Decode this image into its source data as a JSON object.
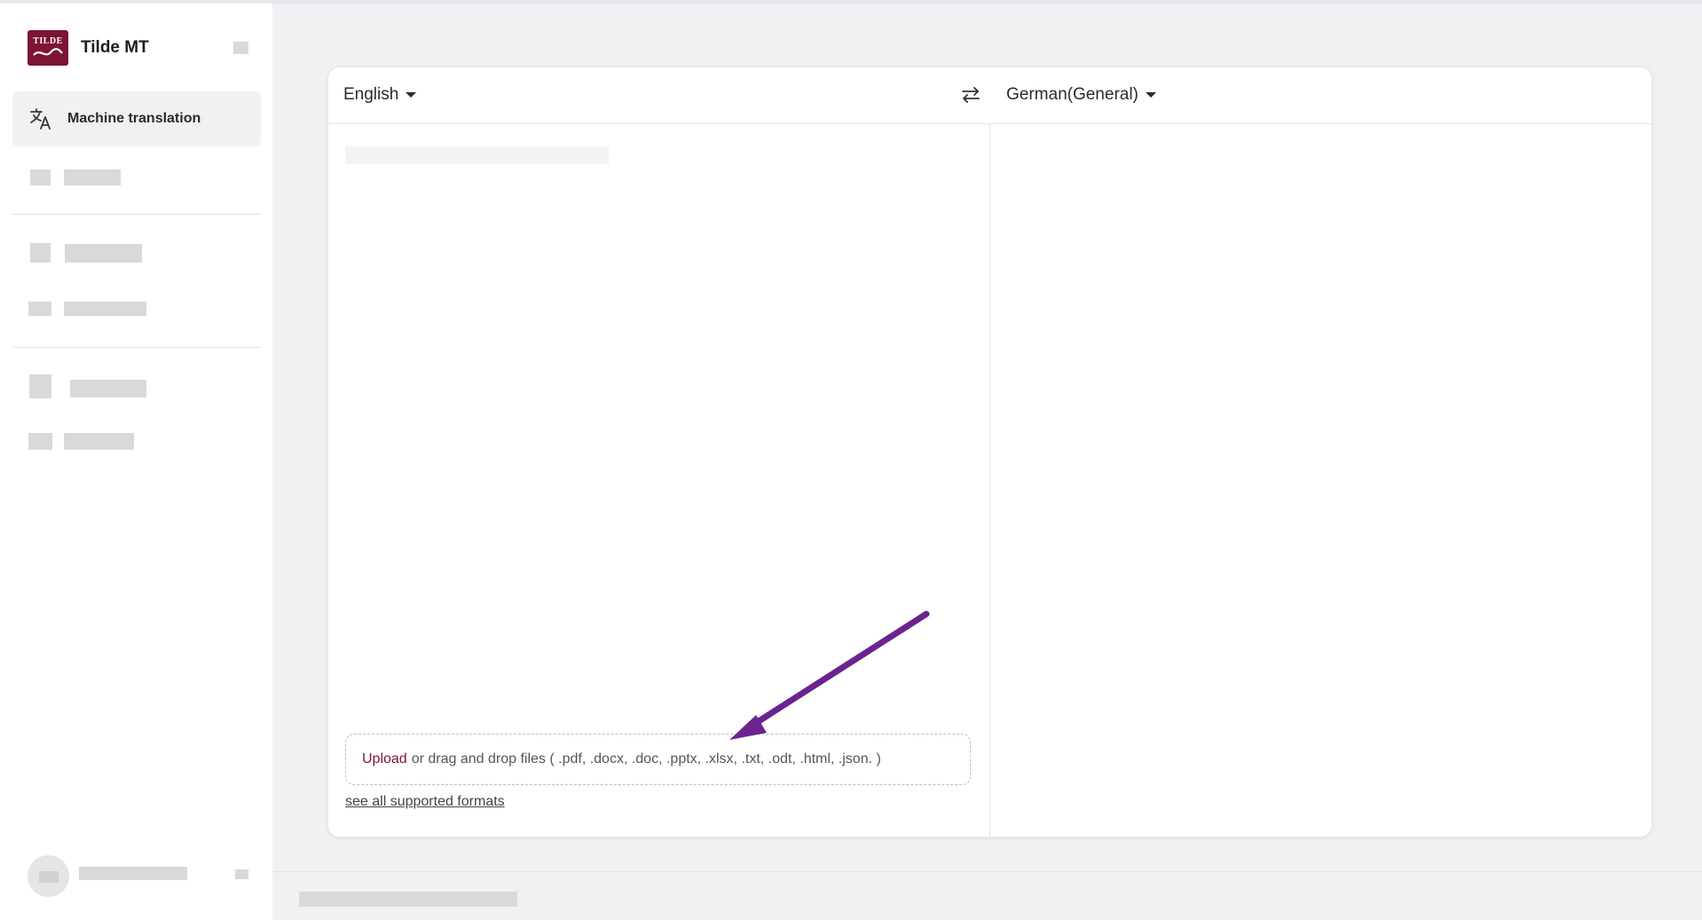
{
  "brand": {
    "name": "Tilde MT",
    "logo_text": "TILDE",
    "logo_color": "#7d1432"
  },
  "sidebar": {
    "active_item": {
      "label": "Machine translation",
      "icon": "translate-icon"
    }
  },
  "translator": {
    "source_language": "English",
    "target_language": "German(General)",
    "swap_icon": "swap-arrows-icon",
    "upload": {
      "link_label": "Upload",
      "rest_text": "or drag and drop files ( .pdf, .docx, .doc, .pptx, .xlsx, .txt, .odt, .html, .json. )"
    },
    "formats_link": "see all supported formats"
  },
  "annotation": {
    "arrow_color": "#6a2390"
  }
}
